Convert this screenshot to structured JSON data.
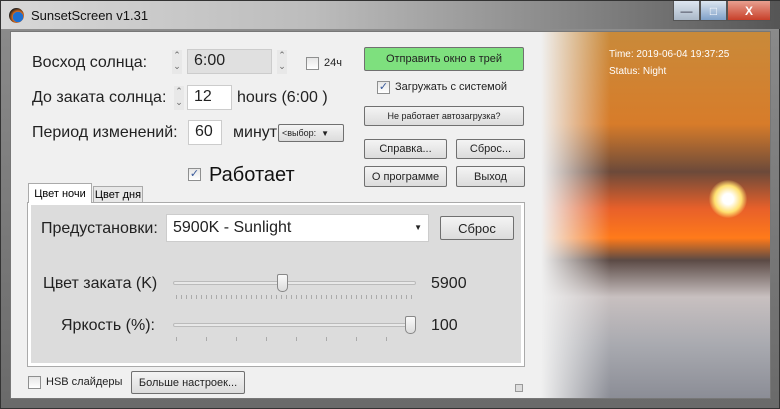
{
  "window": {
    "title": "SunsetScreen v1.31",
    "controls": {
      "minimize": "—",
      "maximize": "□",
      "close": "X"
    }
  },
  "form": {
    "sunrise_label": "Восход солнца:",
    "sunrise_value": "6:00",
    "h24_label": "24ч",
    "h24_checked": false,
    "until_sunset_label": "До заката солнца:",
    "until_sunset_value": "12",
    "hours_label": "hours  (6:00 )",
    "period_label": "Период изменений:",
    "period_value": "60",
    "minutes_label": "минут",
    "period_select": "<выбор:",
    "running_label": "Работает",
    "running_checked": true
  },
  "right_buttons": {
    "tray": "Отправить окно в трей",
    "autostart_label": "Загружать с системой",
    "autostart_checked": true,
    "autostart_help": "Не работает автозагрузка?",
    "help": "Справка...",
    "reset": "Сброс...",
    "about": "О программе",
    "exit": "Выход"
  },
  "status": {
    "time": "Time: 2019-06-04 19:37:25",
    "status": "Status: Night"
  },
  "tabs": [
    {
      "label": "Цвет ночи",
      "active": true
    },
    {
      "label": "Цвет дня",
      "active": false
    }
  ],
  "panel": {
    "presets_label": "Предустановки:",
    "preset_value": "5900K - Sunlight",
    "reset_button": "Сброс",
    "sunset_color_label": "Цвет заката (K)",
    "sunset_color_value": "5900",
    "sunset_color_fraction": 0.45,
    "brightness_label": "Яркость (%):",
    "brightness_value": "100",
    "brightness_fraction": 1.0
  },
  "bottom": {
    "hsb_label": "HSB слайдеры",
    "hsb_checked": false,
    "more_settings": "Больше настроек..."
  },
  "colors": {
    "tray_button": "#7ee07e"
  }
}
